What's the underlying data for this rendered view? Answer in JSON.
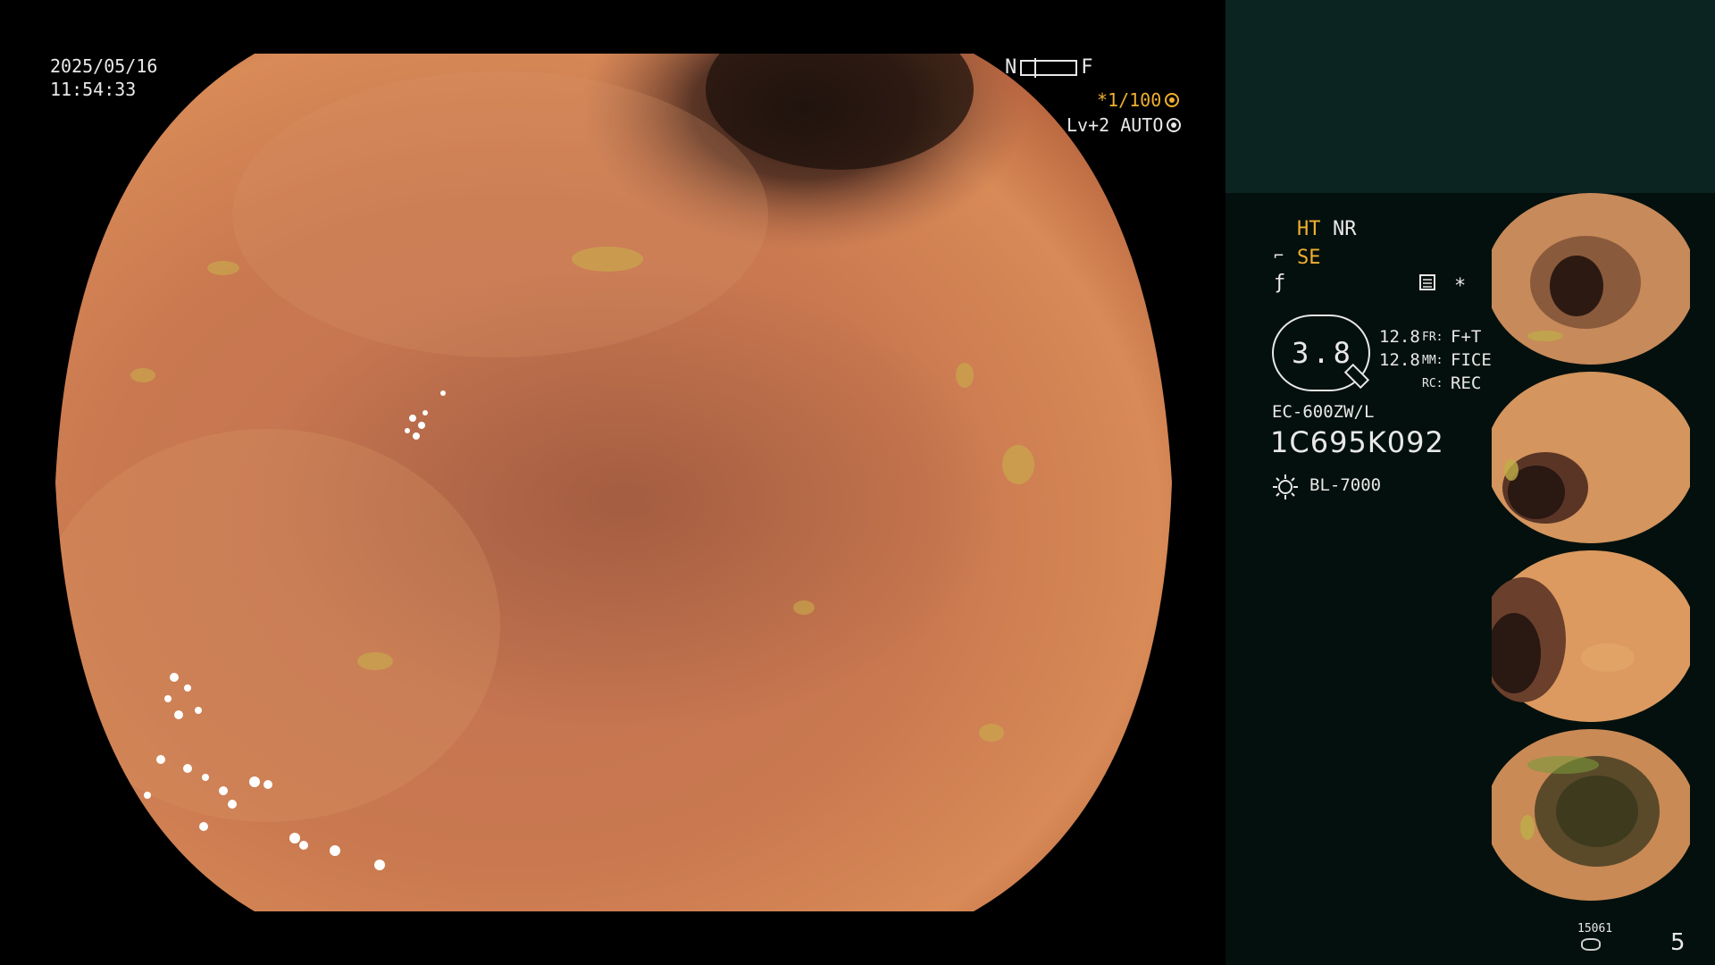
{
  "overlay": {
    "date": "2025/05/16",
    "time": "11:54:33",
    "near_label": "N",
    "far_label": "F",
    "shutter": "*1/100",
    "level": "Lv+2 AUTO"
  },
  "side_panel": {
    "ht": "HT",
    "nr": "NR",
    "se": "SE",
    "star": "*",
    "gauge_value": "3.8",
    "readouts": [
      {
        "num": "12.8",
        "label": "FR:",
        "value": "F+T"
      },
      {
        "num": "12.8",
        "label": "MM:",
        "value": "FICE"
      },
      {
        "num": "",
        "label": "RC:",
        "value": "REC"
      }
    ],
    "scope_model": "EC-600ZW/L",
    "scope_serial": "1C695K092",
    "light_source": "BL-7000",
    "counter": "15061",
    "image_count": "5"
  },
  "colors": {
    "accent_yellow": "#f0b030",
    "panel_top": "#0b2421",
    "panel_bg": "#04100d",
    "tissue": "#c97a55"
  },
  "icons": [
    "shutter-icon",
    "auto-icon",
    "se-icon",
    "f-icon",
    "document-icon",
    "pen-icon",
    "light-source-icon",
    "counter-icon"
  ]
}
